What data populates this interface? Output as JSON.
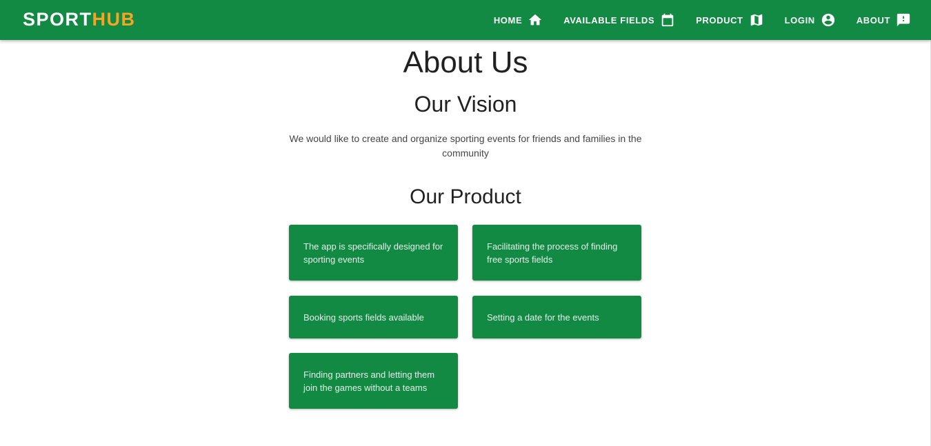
{
  "brand": {
    "part1": "SPORT",
    "part2": "HUB"
  },
  "nav": {
    "home": {
      "label": "HOME",
      "icon": "home-icon"
    },
    "fields": {
      "label": "AVAILABLE FIELDS",
      "icon": "calendar-icon"
    },
    "product": {
      "label": "PRODUCT",
      "icon": "map-icon"
    },
    "login": {
      "label": "LOGIN",
      "icon": "account-circle-icon"
    },
    "about": {
      "label": "ABOUT",
      "icon": "feedback-icon"
    }
  },
  "page": {
    "title": "About Us",
    "vision_title": "Our Vision",
    "vision_text": "We would like to create and organize sporting events for friends and families in the community",
    "product_title": "Our Product",
    "products": [
      "The app is specifically designed for sporting events",
      "Facilitating the process of finding free sports fields",
      "Booking sports fields available",
      "Setting a date for the events",
      "Finding partners and letting them join the games without a teams"
    ]
  },
  "colors": {
    "primary": "#138a43",
    "accent": "#f4a623",
    "card_text": "#e3f1e8"
  }
}
